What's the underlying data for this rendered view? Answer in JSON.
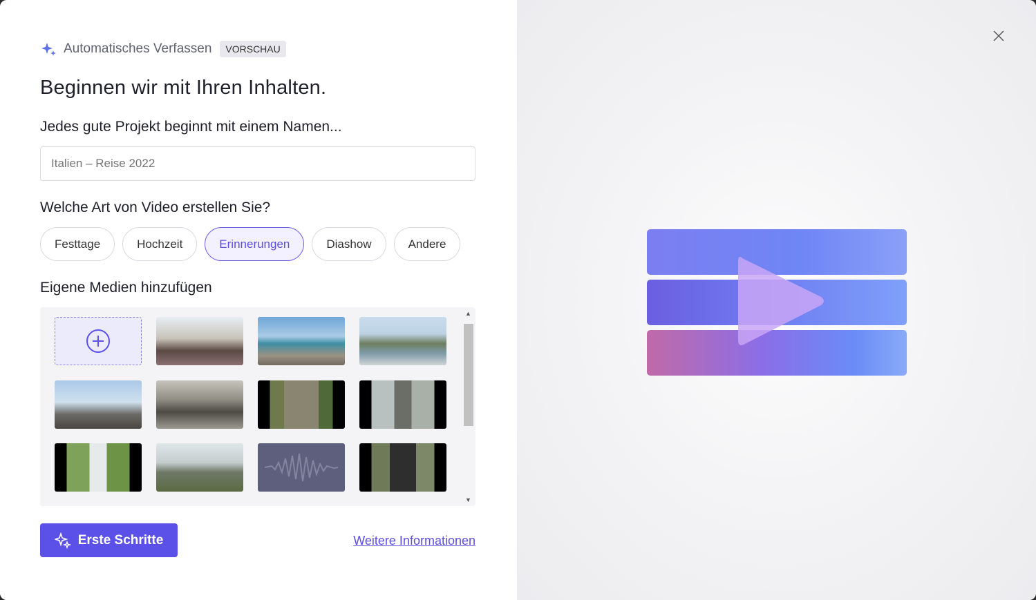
{
  "header": {
    "title": "Automatisches Verfassen",
    "badge": "VORSCHAU"
  },
  "heading": "Beginnen wir mit Ihren Inhalten.",
  "name_section": {
    "label": "Jedes gute Projekt beginnt mit einem Namen...",
    "placeholder": "Italien – Reise 2022"
  },
  "type_section": {
    "label": "Welche Art von Video erstellen Sie?",
    "options": [
      "Festtage",
      "Hochzeit",
      "Erinnerungen",
      "Diashow",
      "Andere"
    ],
    "selected": "Erinnerungen"
  },
  "media_section": {
    "label": "Eigene Medien hinzufügen"
  },
  "footer": {
    "primary_button": "Erste Schritte",
    "link": "Weitere Informationen"
  },
  "colors": {
    "accent": "#5b50e8"
  }
}
